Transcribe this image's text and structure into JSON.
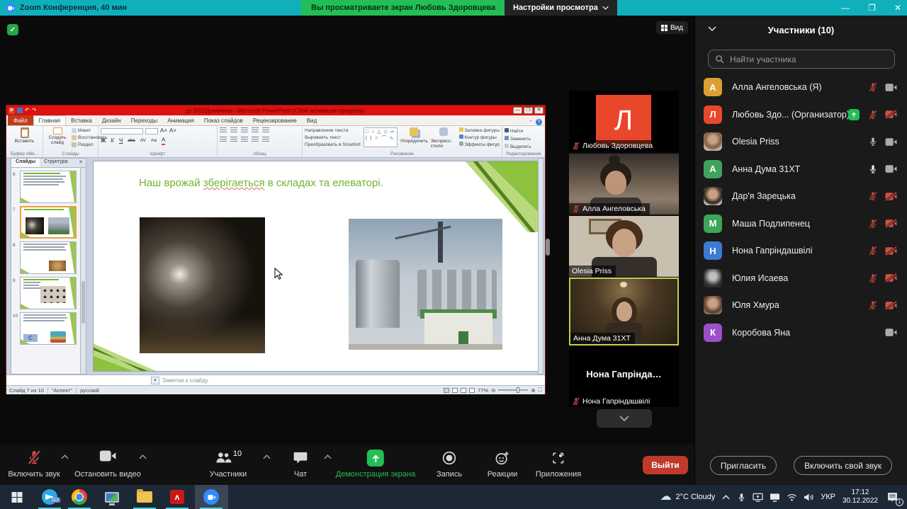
{
  "topbar": {
    "app_title": "Zoom Конференция, 40 мин",
    "banner": "Вы просматриваете экран Любовь Здоровцева",
    "view_settings_label": "Настройки просмотра"
  },
  "shared_screen": {
    "view_button_label": "Вид"
  },
  "powerpoint": {
    "window_title": "дз 2022ДумаАнна  -  Microsoft PowerPoint (Сбой активации продукта)",
    "file_tab": "Файл",
    "tabs": [
      "Главная",
      "Вставка",
      "Дизайн",
      "Переходы",
      "Анимация",
      "Показ слайдов",
      "Рецензирование",
      "Вид"
    ],
    "ribbon": {
      "paste_label": "Вставить",
      "clipboard_group": "Буфер обм...",
      "new_slide_label": "Создать слайд",
      "layout_label": "Макет",
      "reset_label": "Восстановить",
      "section_label": "Раздел",
      "slides_group": "Слайды",
      "bold": "Ж",
      "italic": "К",
      "underline_btn": "Ч",
      "strike": "abc",
      "font_group": "Шрифт",
      "paragraph_group": "Абзац",
      "text_direction_label": "Направление текста",
      "align_text_label": "Выровнять текст",
      "smartart_label": "Преобразовать в SmartArt",
      "arrange_label": "Упорядочить",
      "quick_styles_label": "Экспресс-стили",
      "shape_fill_label": "Заливка фигуры",
      "shape_outline_label": "Контур фигуры",
      "shape_effects_label": "Эффекты фигур",
      "drawing_group": "Рисование",
      "find_label": "Найти",
      "replace_label": "Заменить",
      "select_label": "Выделить",
      "editing_group": "Редактирование",
      "shapes_row1": "□ ○ △ ◇ ⇨",
      "shapes_row2": "( ) ☆ ⌒ ∿"
    },
    "left_panel": {
      "tab_slides": "Слайды",
      "tab_outline": "Структура",
      "slide_numbers": [
        "6",
        "7",
        "8",
        "9",
        "10"
      ]
    },
    "slide": {
      "title_part1": "Наш врожай ",
      "title_misspelled": "зберігаеться",
      "title_part3": " в складах та елеваторі."
    },
    "notes_placeholder": "Заметки к слайду",
    "status_bar": {
      "slide_counter": "Слайд 7 из 10",
      "theme_name": "\"Аспект\"",
      "language": "русский",
      "zoom_level": "77%"
    }
  },
  "video_strip": {
    "tiles": [
      {
        "name": "Любовь Здоровцева",
        "avatar_letter": "Л",
        "avatar_style": "background:#e9472b",
        "mic": "muted"
      },
      {
        "name": "Алла Ангеловська",
        "mic": "muted"
      },
      {
        "name": "Olesia Priss",
        "mic": "none"
      },
      {
        "name": "Анна Дума 31ХТ",
        "mic": "none",
        "state": "active"
      },
      {
        "name": "Нона Гапріндашвілі",
        "center_text": "Нона Гапрінда…",
        "mic": "muted"
      }
    ]
  },
  "participants_panel": {
    "header": "Участники (10)",
    "search_placeholder": "Найти участника",
    "invite_label": "Пригласить",
    "unmute_label": "Включить свой звук",
    "list": [
      {
        "name": "Алла Ангеловська (Я)",
        "letter": "А",
        "avatar_style": "background:#dba032",
        "mic": "muted",
        "cam": "on"
      },
      {
        "name": "Любовь Здо... (Организатор)",
        "letter": "Л",
        "avatar_style": "background:#e9472b",
        "mic": "muted",
        "cam": "off",
        "share": "sharing"
      },
      {
        "name": "Olesia Priss",
        "letter": "",
        "photo": "photo-olesia",
        "mic": "on",
        "cam": "on"
      },
      {
        "name": "Анна Дума 31ХТ",
        "letter": "А",
        "avatar_style": "background:#3fa45b",
        "mic": "active",
        "cam": "on"
      },
      {
        "name": "Дар'я Зарецька",
        "letter": "",
        "photo": "photo-daria",
        "mic": "muted",
        "cam": "off"
      },
      {
        "name": "Маша Подлипенец",
        "letter": "М",
        "avatar_style": "background:#3fa45b",
        "mic": "muted",
        "cam": "off"
      },
      {
        "name": "Нона Гапріндашвілі",
        "letter": "Н",
        "avatar_style": "background:#3b7bd4",
        "mic": "muted",
        "cam": "off"
      },
      {
        "name": "Юлия Исаева",
        "letter": "",
        "photo": "photo-yulia",
        "mic": "muted",
        "cam": "off"
      },
      {
        "name": "Юля Хмура",
        "letter": "",
        "photo": "photo-khmura",
        "mic": "muted",
        "cam": "off"
      },
      {
        "name": "Коробова Яна",
        "letter": "К",
        "avatar_style": "background:#9c50c8",
        "mic": "none",
        "cam": "on"
      }
    ]
  },
  "toolbar": {
    "mute_label": "Включить звук",
    "stop_video_label": "Остановить видео",
    "participants_label": "Участники",
    "participants_count": "10",
    "chat_label": "Чат",
    "share_label": "Демонстрация экрана",
    "record_label": "Запись",
    "reactions_label": "Реакции",
    "apps_label": "Приложения",
    "leave_label": "Выйти"
  },
  "taskbar": {
    "telegram_badge": "112",
    "weather": "2°C Cloudy",
    "language": "УКР",
    "time": "17:12",
    "date": "30.12.2022",
    "notification_badge": "1"
  },
  "colors": {
    "topbar_teal": "#0fb0bc",
    "banner_green": "#23be56",
    "ppt_titlebar_red": "#de1010",
    "slide_title_green": "#6fb52c",
    "theme_green": "#8cc23e",
    "active_speaker_border": "#c3ce4e",
    "muted_red": "#d05043",
    "leave_red": "#c0392b",
    "taskbar_underline": "#55c8d8"
  }
}
